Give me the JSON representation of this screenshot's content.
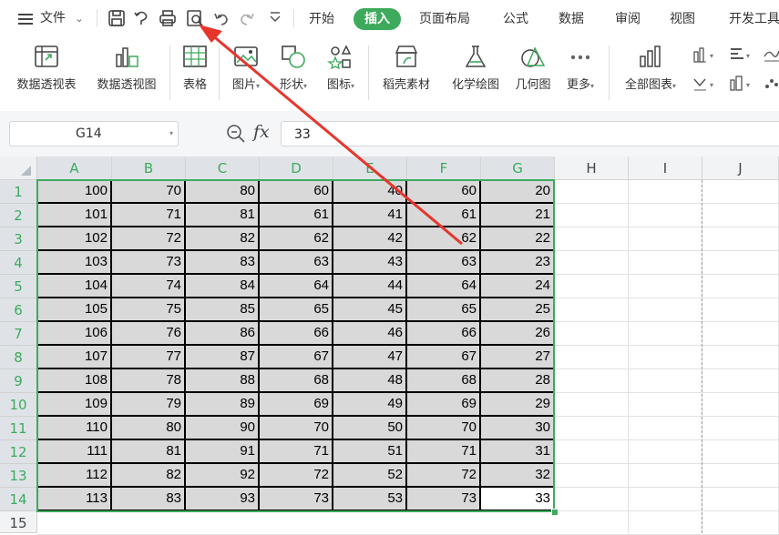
{
  "menu": {
    "file_label": "文件"
  },
  "tabs": [
    {
      "label": "开始",
      "active": false
    },
    {
      "label": "插入",
      "active": true
    },
    {
      "label": "页面布局",
      "active": false
    },
    {
      "label": "公式",
      "active": false
    },
    {
      "label": "数据",
      "active": false
    },
    {
      "label": "审阅",
      "active": false
    },
    {
      "label": "视图",
      "active": false
    },
    {
      "label": "开发工具",
      "active": false
    }
  ],
  "ribbon": {
    "pivot_table": "数据透视表",
    "pivot_chart": "数据透视图",
    "table": "表格",
    "picture": "图片",
    "shape": "形状",
    "icon": "图标",
    "docer": "稻壳素材",
    "chem": "化学绘图",
    "geometry": "几何图",
    "more": "更多",
    "all_charts": "全部图表"
  },
  "formula_bar": {
    "name_box": "G14",
    "fx_symbol": "fx",
    "value": "33"
  },
  "columns": [
    "A",
    "B",
    "C",
    "D",
    "E",
    "F",
    "G",
    "H",
    "I",
    "J"
  ],
  "rows": [
    "1",
    "2",
    "3",
    "4",
    "5",
    "6",
    "7",
    "8",
    "9",
    "10",
    "11",
    "12",
    "13",
    "14",
    "15"
  ],
  "cells": [
    [
      "100",
      "70",
      "80",
      "60",
      "40",
      "60",
      "20"
    ],
    [
      "101",
      "71",
      "81",
      "61",
      "41",
      "61",
      "21"
    ],
    [
      "102",
      "72",
      "82",
      "62",
      "42",
      "62",
      "22"
    ],
    [
      "103",
      "73",
      "83",
      "63",
      "43",
      "63",
      "23"
    ],
    [
      "104",
      "74",
      "84",
      "64",
      "44",
      "64",
      "24"
    ],
    [
      "105",
      "75",
      "85",
      "65",
      "45",
      "65",
      "25"
    ],
    [
      "106",
      "76",
      "86",
      "66",
      "46",
      "66",
      "26"
    ],
    [
      "107",
      "77",
      "87",
      "67",
      "47",
      "67",
      "27"
    ],
    [
      "108",
      "78",
      "88",
      "68",
      "48",
      "68",
      "28"
    ],
    [
      "109",
      "79",
      "89",
      "69",
      "49",
      "69",
      "29"
    ],
    [
      "110",
      "80",
      "90",
      "70",
      "50",
      "70",
      "30"
    ],
    [
      "111",
      "81",
      "91",
      "71",
      "51",
      "71",
      "31"
    ],
    [
      "112",
      "82",
      "92",
      "72",
      "52",
      "72",
      "32"
    ],
    [
      "113",
      "83",
      "93",
      "73",
      "53",
      "73",
      "33"
    ]
  ],
  "active_cell": {
    "row": 14,
    "col": "G"
  },
  "colors": {
    "accent": "#3daa5c",
    "arrow": "#e8352b",
    "selection": "#d9d9d9"
  },
  "annotation": {
    "type": "arrow",
    "points_to": "print-preview-icon"
  }
}
